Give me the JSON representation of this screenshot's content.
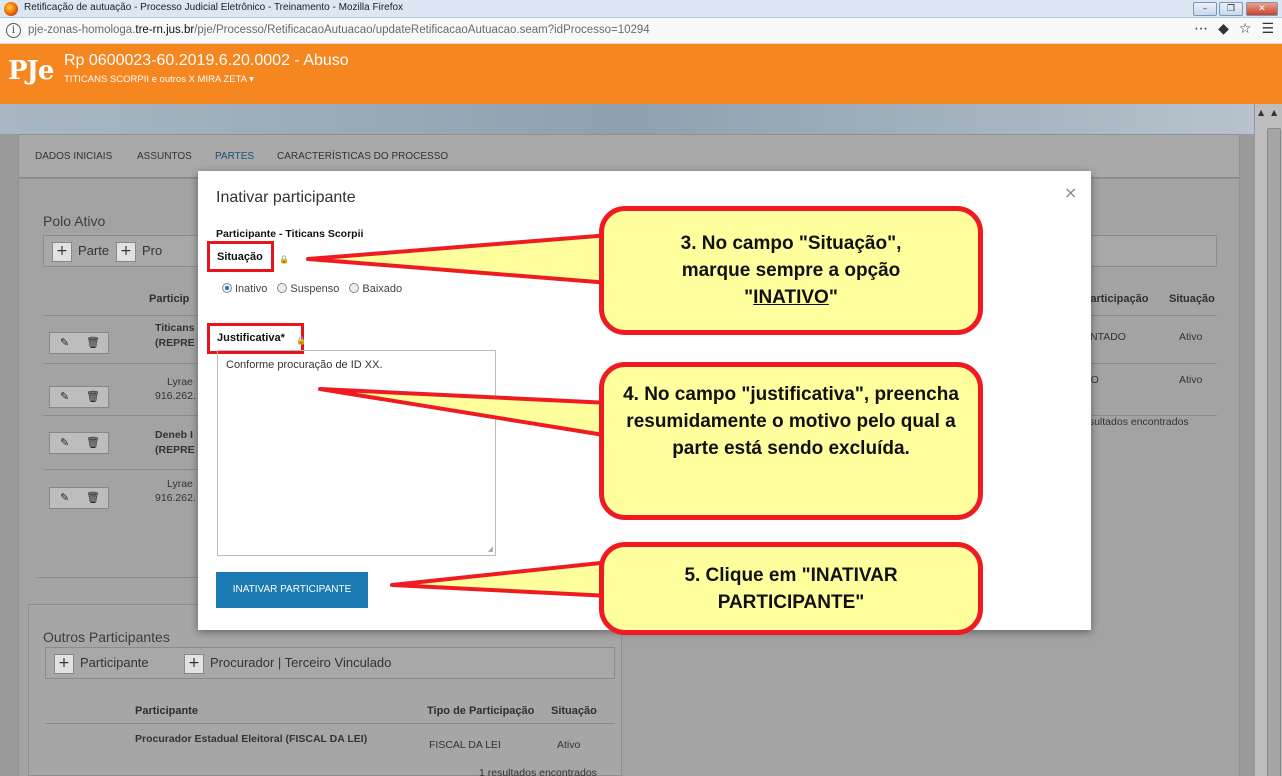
{
  "window": {
    "title": "Retificação de autuação - Processo Judicial Eletrônico - Treinamento - Mozilla Firefox",
    "url_prefix": "pje-zonas-homologa.",
    "url_domain": "tre-rn.jus.br",
    "url_path": "/pje/Processo/RetificacaoAutuacao/updateRetificacaoAutuacao.seam?idProcesso=10294"
  },
  "header": {
    "logo": "PJe",
    "process_title": "Rp 0600023-60.2019.6.20.0002 - Abuso",
    "parties": "TITICANS SCORPII e outros X MIRA ZETA ▾"
  },
  "tabs": [
    "DADOS INICIAIS",
    "ASSUNTOS",
    "PARTES",
    "CARACTERÍSTICAS DO PROCESSO"
  ],
  "polo_ativo": {
    "title": "Polo Ativo",
    "btn_parte": "Parte",
    "btn_proc": "Pro",
    "col_participante": "Particip",
    "col_right_tipo": "Participação",
    "col_right_situacao": "Situação",
    "rows": [
      {
        "name": "Titicans",
        "sub": "(REPRE",
        "bold": true,
        "tipo": "ENTADO",
        "situacao": "Ativo"
      },
      {
        "name": "Lyrae",
        "sub": "916.262.",
        "bold": false,
        "tipo": "DO",
        "situacao": "Ativo"
      },
      {
        "name": "Deneb I",
        "sub": "(REPRE",
        "bold": true,
        "tipo": "",
        "situacao": ""
      },
      {
        "name": "Lyrae",
        "sub": "916.262.",
        "bold": false,
        "tipo": "",
        "situacao": ""
      }
    ],
    "results": "esultados encontrados"
  },
  "outros": {
    "title": "Outros Participantes",
    "btn_participante": "Participante",
    "btn_procurador": "Procurador | Terceiro Vinculado",
    "col_participante": "Participante",
    "col_tipo": "Tipo de Participação",
    "col_situacao": "Situação",
    "row": {
      "name": "Procurador Estadual Eleitoral (FISCAL DA LEI)",
      "tipo": "FISCAL DA LEI",
      "situacao": "Ativo"
    },
    "results": "1 resultados encontrados"
  },
  "modal": {
    "title": "Inativar participante",
    "close": "×",
    "participant": "Participante - Titicans Scorpii",
    "situacao_label": "Situação",
    "options": [
      "Inativo",
      "Suspenso",
      "Baixado"
    ],
    "selected": "Inativo",
    "justificativa_label": "Justificativa*",
    "justificativa_value": "Conforme procuração de ID XX.",
    "submit": "INATIVAR PARTICIPANTE"
  },
  "callouts": {
    "c3_line1": "3. No campo \"Situação\",",
    "c3_line2": "marque sempre a opção",
    "c3_q1": "\"",
    "c3_emph": "INATIVO",
    "c3_q2": "\"",
    "c4": "4. No campo \"justificativa\", preencha resumidamente o motivo pelo qual a parte está sendo excluída.",
    "c5": "5. Clique em \"INATIVAR PARTICIPANTE\""
  },
  "colors": {
    "orange": "#f68620",
    "primary": "#1b7ab1",
    "callout_bg": "#ffff9e",
    "callout_border": "#ef1b22"
  }
}
